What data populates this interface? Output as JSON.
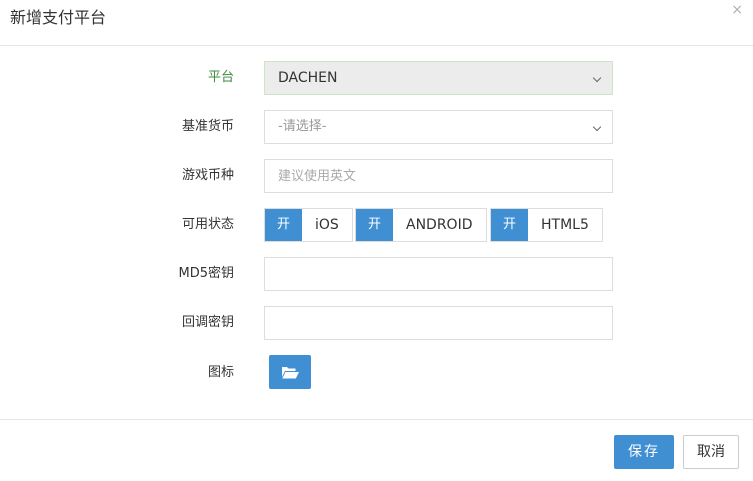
{
  "dialog": {
    "title": "新增支付平台",
    "close_glyph": "×"
  },
  "form": {
    "platform": {
      "label": "平台",
      "value": "DACHEN"
    },
    "base_currency": {
      "label": "基准货币",
      "value": "-请选择-"
    },
    "game_currency": {
      "label": "游戏币种",
      "value": "",
      "placeholder": "建议使用英文"
    },
    "availability": {
      "label": "可用状态",
      "toggles": [
        {
          "state": "开",
          "name": "iOS"
        },
        {
          "state": "开",
          "name": "ANDROID"
        },
        {
          "state": "开",
          "name": "HTML5"
        }
      ]
    },
    "md5_key": {
      "label": "MD5密钥",
      "value": ""
    },
    "callback_key": {
      "label": "回调密钥",
      "value": ""
    },
    "icon": {
      "label": "图标",
      "button_icon": "folder-open-icon"
    }
  },
  "footer": {
    "save_label": "保存",
    "cancel_label": "取消"
  },
  "colors": {
    "primary": "#3f8fd2",
    "platform_label": "#3c8d3c"
  }
}
